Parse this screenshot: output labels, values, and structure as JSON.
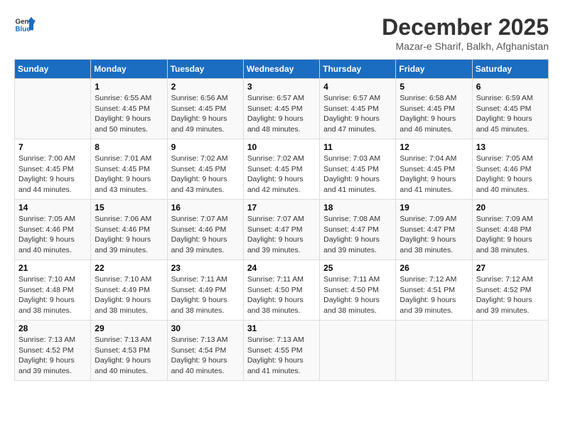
{
  "logo": {
    "general": "General",
    "blue": "Blue"
  },
  "header": {
    "month_year": "December 2025",
    "location": "Mazar-e Sharif, Balkh, Afghanistan"
  },
  "days_of_week": [
    "Sunday",
    "Monday",
    "Tuesday",
    "Wednesday",
    "Thursday",
    "Friday",
    "Saturday"
  ],
  "weeks": [
    [
      {
        "day": "",
        "content": ""
      },
      {
        "day": "1",
        "content": "Sunrise: 6:55 AM\nSunset: 4:45 PM\nDaylight: 9 hours\nand 50 minutes."
      },
      {
        "day": "2",
        "content": "Sunrise: 6:56 AM\nSunset: 4:45 PM\nDaylight: 9 hours\nand 49 minutes."
      },
      {
        "day": "3",
        "content": "Sunrise: 6:57 AM\nSunset: 4:45 PM\nDaylight: 9 hours\nand 48 minutes."
      },
      {
        "day": "4",
        "content": "Sunrise: 6:57 AM\nSunset: 4:45 PM\nDaylight: 9 hours\nand 47 minutes."
      },
      {
        "day": "5",
        "content": "Sunrise: 6:58 AM\nSunset: 4:45 PM\nDaylight: 9 hours\nand 46 minutes."
      },
      {
        "day": "6",
        "content": "Sunrise: 6:59 AM\nSunset: 4:45 PM\nDaylight: 9 hours\nand 45 minutes."
      }
    ],
    [
      {
        "day": "7",
        "content": "Sunrise: 7:00 AM\nSunset: 4:45 PM\nDaylight: 9 hours\nand 44 minutes."
      },
      {
        "day": "8",
        "content": "Sunrise: 7:01 AM\nSunset: 4:45 PM\nDaylight: 9 hours\nand 43 minutes."
      },
      {
        "day": "9",
        "content": "Sunrise: 7:02 AM\nSunset: 4:45 PM\nDaylight: 9 hours\nand 43 minutes."
      },
      {
        "day": "10",
        "content": "Sunrise: 7:02 AM\nSunset: 4:45 PM\nDaylight: 9 hours\nand 42 minutes."
      },
      {
        "day": "11",
        "content": "Sunrise: 7:03 AM\nSunset: 4:45 PM\nDaylight: 9 hours\nand 41 minutes."
      },
      {
        "day": "12",
        "content": "Sunrise: 7:04 AM\nSunset: 4:45 PM\nDaylight: 9 hours\nand 41 minutes."
      },
      {
        "day": "13",
        "content": "Sunrise: 7:05 AM\nSunset: 4:46 PM\nDaylight: 9 hours\nand 40 minutes."
      }
    ],
    [
      {
        "day": "14",
        "content": "Sunrise: 7:05 AM\nSunset: 4:46 PM\nDaylight: 9 hours\nand 40 minutes."
      },
      {
        "day": "15",
        "content": "Sunrise: 7:06 AM\nSunset: 4:46 PM\nDaylight: 9 hours\nand 39 minutes."
      },
      {
        "day": "16",
        "content": "Sunrise: 7:07 AM\nSunset: 4:46 PM\nDaylight: 9 hours\nand 39 minutes."
      },
      {
        "day": "17",
        "content": "Sunrise: 7:07 AM\nSunset: 4:47 PM\nDaylight: 9 hours\nand 39 minutes."
      },
      {
        "day": "18",
        "content": "Sunrise: 7:08 AM\nSunset: 4:47 PM\nDaylight: 9 hours\nand 39 minutes."
      },
      {
        "day": "19",
        "content": "Sunrise: 7:09 AM\nSunset: 4:47 PM\nDaylight: 9 hours\nand 38 minutes."
      },
      {
        "day": "20",
        "content": "Sunrise: 7:09 AM\nSunset: 4:48 PM\nDaylight: 9 hours\nand 38 minutes."
      }
    ],
    [
      {
        "day": "21",
        "content": "Sunrise: 7:10 AM\nSunset: 4:48 PM\nDaylight: 9 hours\nand 38 minutes."
      },
      {
        "day": "22",
        "content": "Sunrise: 7:10 AM\nSunset: 4:49 PM\nDaylight: 9 hours\nand 38 minutes."
      },
      {
        "day": "23",
        "content": "Sunrise: 7:11 AM\nSunset: 4:49 PM\nDaylight: 9 hours\nand 38 minutes."
      },
      {
        "day": "24",
        "content": "Sunrise: 7:11 AM\nSunset: 4:50 PM\nDaylight: 9 hours\nand 38 minutes."
      },
      {
        "day": "25",
        "content": "Sunrise: 7:11 AM\nSunset: 4:50 PM\nDaylight: 9 hours\nand 38 minutes."
      },
      {
        "day": "26",
        "content": "Sunrise: 7:12 AM\nSunset: 4:51 PM\nDaylight: 9 hours\nand 39 minutes."
      },
      {
        "day": "27",
        "content": "Sunrise: 7:12 AM\nSunset: 4:52 PM\nDaylight: 9 hours\nand 39 minutes."
      }
    ],
    [
      {
        "day": "28",
        "content": "Sunrise: 7:13 AM\nSunset: 4:52 PM\nDaylight: 9 hours\nand 39 minutes."
      },
      {
        "day": "29",
        "content": "Sunrise: 7:13 AM\nSunset: 4:53 PM\nDaylight: 9 hours\nand 40 minutes."
      },
      {
        "day": "30",
        "content": "Sunrise: 7:13 AM\nSunset: 4:54 PM\nDaylight: 9 hours\nand 40 minutes."
      },
      {
        "day": "31",
        "content": "Sunrise: 7:13 AM\nSunset: 4:55 PM\nDaylight: 9 hours\nand 41 minutes."
      },
      {
        "day": "",
        "content": ""
      },
      {
        "day": "",
        "content": ""
      },
      {
        "day": "",
        "content": ""
      }
    ]
  ]
}
